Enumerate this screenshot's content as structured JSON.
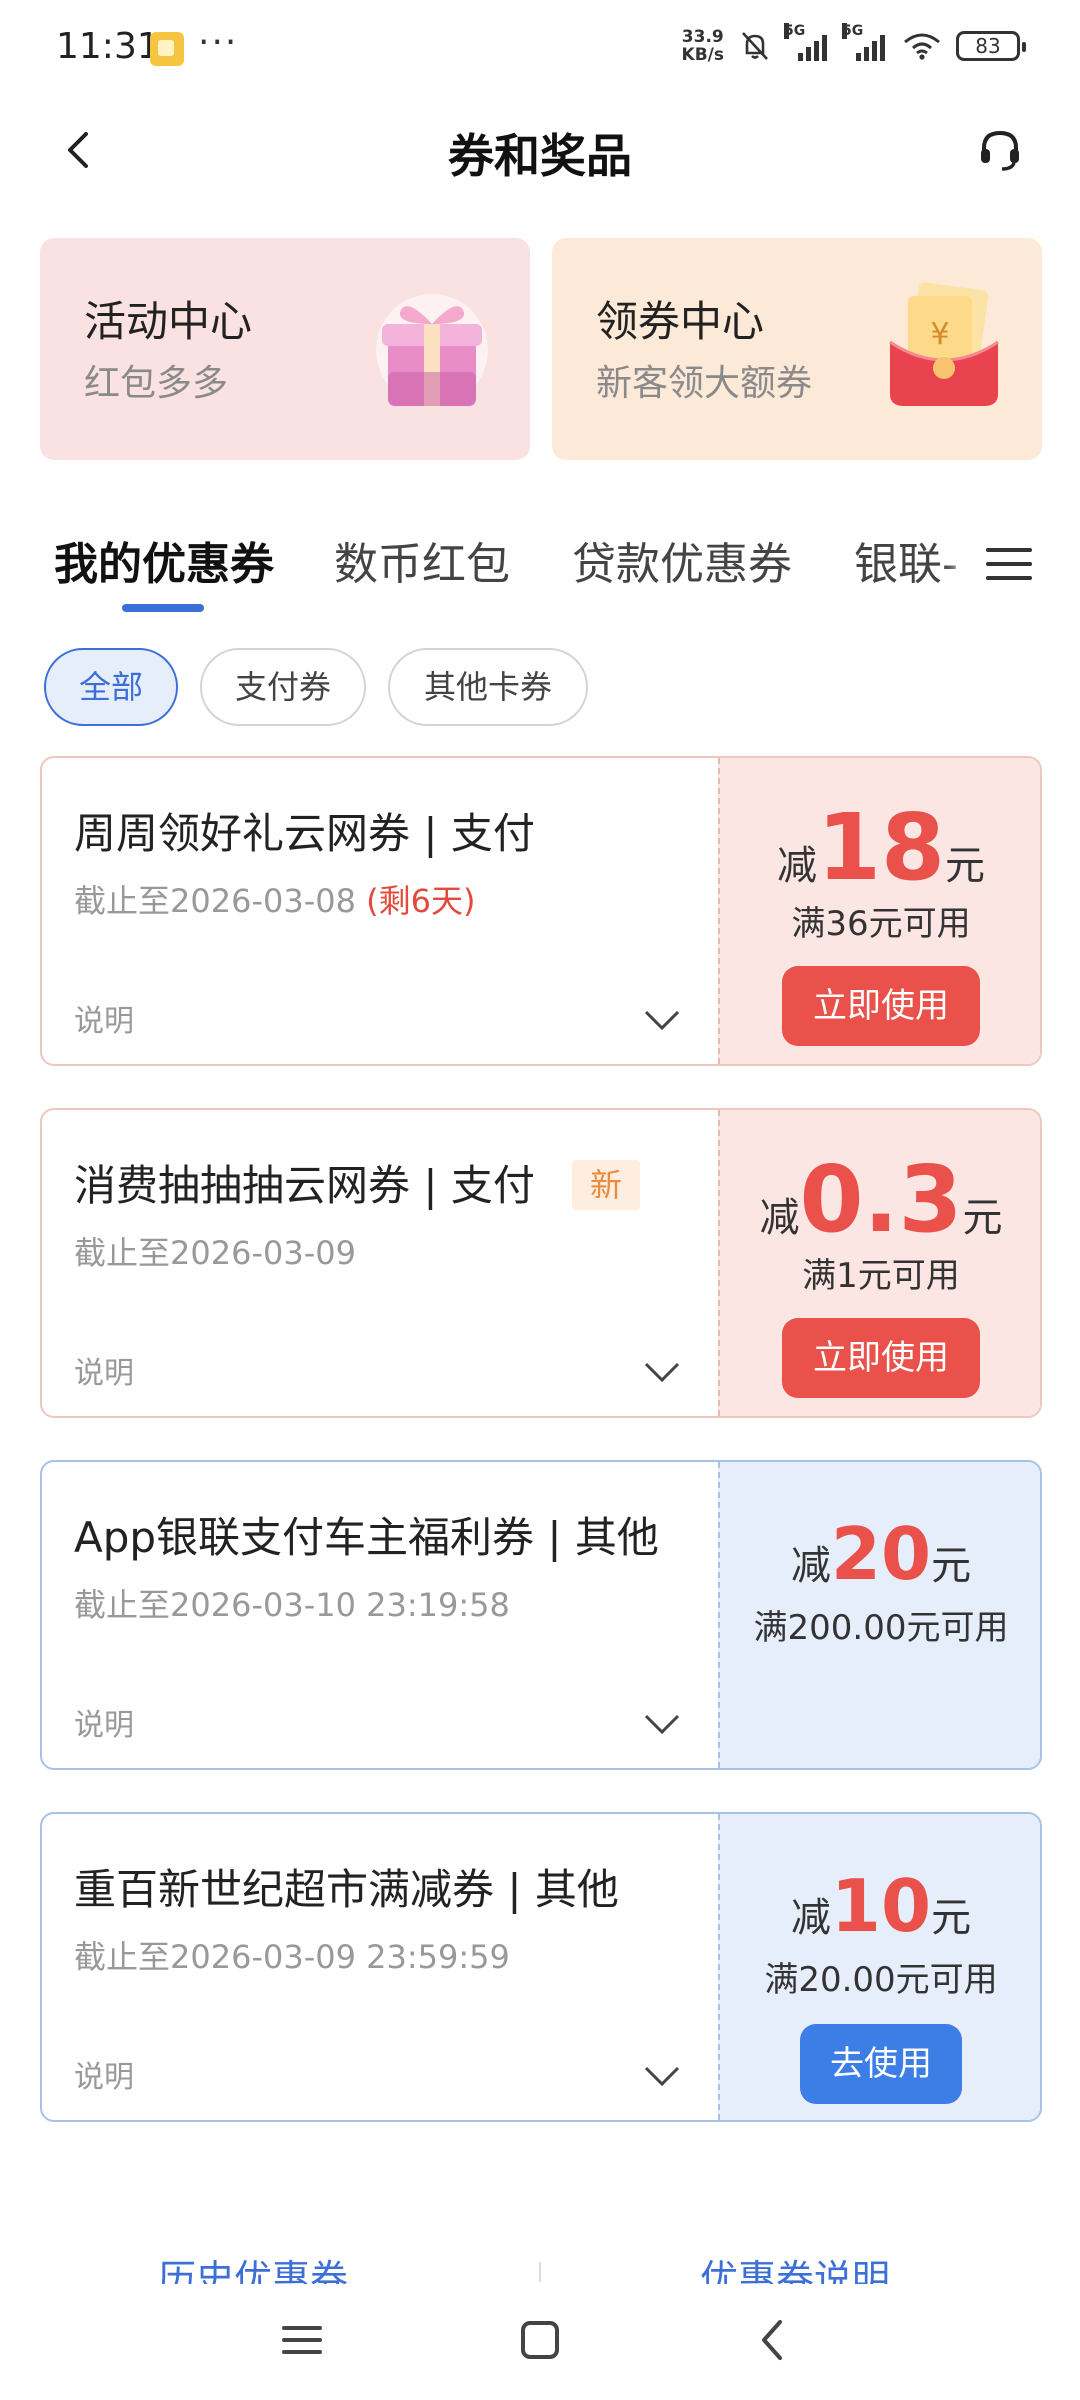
{
  "status_bar": {
    "time": "11:31",
    "dots": "···",
    "net_speed_value": "33.9",
    "net_speed_unit": "KB/s",
    "sim1_tag": "5G",
    "sim2_tag": "5G",
    "battery": "83"
  },
  "header": {
    "title": "券和奖品",
    "back_icon": "chevron-left-icon",
    "service_icon": "headset-icon"
  },
  "promos": [
    {
      "title": "活动中心",
      "subtitle": "红包多多",
      "icon": "gift-box-icon"
    },
    {
      "title": "领券中心",
      "subtitle": "新客领大额券",
      "icon": "red-envelope-icon"
    }
  ],
  "tabs": [
    {
      "label": "我的优惠券",
      "active": true
    },
    {
      "label": "数币红包"
    },
    {
      "label": "贷款优惠券"
    },
    {
      "label": "银联-"
    }
  ],
  "filters": [
    {
      "label": "全部",
      "active": true
    },
    {
      "label": "支付券"
    },
    {
      "label": "其他卡券"
    }
  ],
  "coupons": [
    {
      "name": "周周领好礼云网券 | 支付",
      "expire": "截止至2026-03-08",
      "remaining": "(剩6天)",
      "desc_label": "说明",
      "amount_prefix": "减",
      "amount": "18",
      "amount_unit": "元",
      "condition": "满36元可用",
      "button": "立即使用",
      "theme": "red"
    },
    {
      "name": "消费抽抽抽云网券 | 支付",
      "badge": "新",
      "expire": "截止至2026-03-09",
      "desc_label": "说明",
      "amount_prefix": "减",
      "amount": "0.3",
      "amount_unit": "元",
      "condition": "满1元可用",
      "button": "立即使用",
      "theme": "red"
    },
    {
      "name": "App银联支付车主福利券 | 其他",
      "expire": "截止至2026-03-10 23:19:58",
      "desc_label": "说明",
      "amount_prefix": "减",
      "amount": "20",
      "amount_unit": "元",
      "condition": "满200.00元可用",
      "theme": "blue"
    },
    {
      "name": "重百新世纪超市满减券 | 其他",
      "expire": "截止至2026-03-09 23:59:59",
      "desc_label": "说明",
      "amount_prefix": "减",
      "amount": "10",
      "amount_unit": "元",
      "condition": "满20.00元可用",
      "button": "去使用",
      "theme": "blue"
    }
  ],
  "footer": {
    "history_link": "历史优惠券",
    "rules_link": "优惠券说明"
  },
  "colors": {
    "accent_blue": "#3d6fd8",
    "coupon_red": "#e9514a",
    "expire_red": "#e34a3c"
  }
}
